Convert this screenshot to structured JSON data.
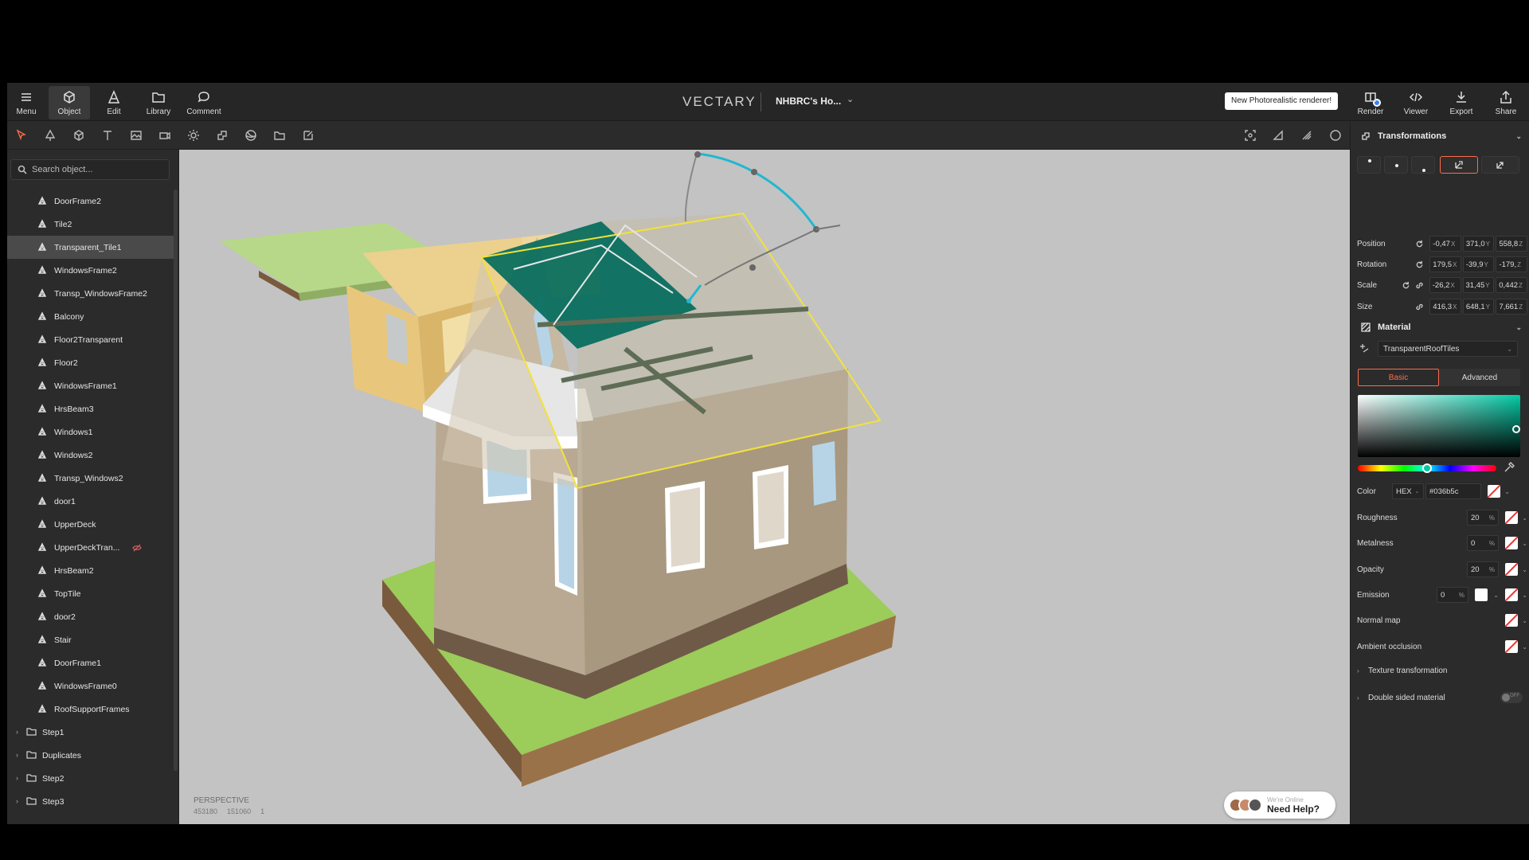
{
  "topbar": {
    "menu_label": "Menu",
    "object_label": "Object",
    "edit_label": "Edit",
    "library_label": "Library",
    "comment_label": "Comment",
    "logo": "VECTARY",
    "project_name": "NHBRC's Ho...",
    "renderer_tip": "New Photorealistic renderer!",
    "render_label": "Render",
    "viewer_label": "Viewer",
    "export_label": "Export",
    "share_label": "Share"
  },
  "tools": {
    "left": [
      "select-icon",
      "pen-icon",
      "box-icon",
      "text-icon",
      "image-icon",
      "camera-icon",
      "light-icon",
      "transform-icon",
      "sphere-icon",
      "folder-icon",
      "annotation-icon"
    ],
    "right": [
      "focus-icon",
      "material-preview-icon",
      "lighting-icon",
      "circle-icon"
    ]
  },
  "outliner": {
    "search_placeholder": "Search object...",
    "items": [
      {
        "label": "DoorFrame2",
        "selected": false,
        "hidden": false
      },
      {
        "label": "Tile2",
        "selected": false,
        "hidden": false
      },
      {
        "label": "Transparent_Tile1",
        "selected": true,
        "hidden": false
      },
      {
        "label": "WindowsFrame2",
        "selected": false,
        "hidden": false
      },
      {
        "label": "Transp_WindowsFrame2",
        "selected": false,
        "hidden": false
      },
      {
        "label": "Balcony",
        "selected": false,
        "hidden": false
      },
      {
        "label": "Floor2Transparent",
        "selected": false,
        "hidden": false
      },
      {
        "label": "Floor2",
        "selected": false,
        "hidden": false
      },
      {
        "label": "WindowsFrame1",
        "selected": false,
        "hidden": false
      },
      {
        "label": "HrsBeam3",
        "selected": false,
        "hidden": false
      },
      {
        "label": "Windows1",
        "selected": false,
        "hidden": false
      },
      {
        "label": "Windows2",
        "selected": false,
        "hidden": false
      },
      {
        "label": "Transp_Windows2",
        "selected": false,
        "hidden": false
      },
      {
        "label": "door1",
        "selected": false,
        "hidden": false
      },
      {
        "label": "UpperDeck",
        "selected": false,
        "hidden": false
      },
      {
        "label": "UpperDeckTran...",
        "selected": false,
        "hidden": true
      },
      {
        "label": "HrsBeam2",
        "selected": false,
        "hidden": false
      },
      {
        "label": "TopTile",
        "selected": false,
        "hidden": false
      },
      {
        "label": "door2",
        "selected": false,
        "hidden": false
      },
      {
        "label": "Stair",
        "selected": false,
        "hidden": false
      },
      {
        "label": "DoorFrame1",
        "selected": false,
        "hidden": false
      },
      {
        "label": "WindowsFrame0",
        "selected": false,
        "hidden": false
      },
      {
        "label": "RoofSupportFrames",
        "selected": false,
        "hidden": false
      }
    ],
    "folders": [
      "Step1",
      "Duplicates",
      "Step2",
      "Step3"
    ]
  },
  "viewport": {
    "mode": "PERSPECTIVE",
    "stats": [
      "453180",
      "151060",
      "1"
    ],
    "help_online": "We're Online",
    "help_label": "Need Help?",
    "colors": {
      "roof": "#036b5c",
      "ground": "#9ccc5a",
      "soil": "#7a5a3c",
      "walls": "#b9a892",
      "second_floor": "#edd190",
      "selection": "#f2e23a",
      "gizmo": "#1fb8d0"
    }
  },
  "transformations": {
    "title": "Transformations",
    "rows": [
      {
        "label": "Position",
        "values": [
          "-0,47",
          "371,0",
          "558,8"
        ]
      },
      {
        "label": "Rotation",
        "values": [
          "179,5",
          "-39,9",
          "-179,"
        ]
      },
      {
        "label": "Scale",
        "values": [
          "-26,2",
          "31,45",
          "0,442"
        ]
      },
      {
        "label": "Size",
        "values": [
          "416,3",
          "648,1",
          "7,661"
        ]
      }
    ],
    "axes": [
      "X",
      "Y",
      "Z"
    ]
  },
  "material": {
    "title": "Material",
    "name": "TransparentRoofTiles",
    "tab_basic": "Basic",
    "tab_advanced": "Advanced",
    "color_label": "Color",
    "color_format": "HEX",
    "color_hex": "#036b5c",
    "picker_color": "#04c9a5",
    "roughness_label": "Roughness",
    "roughness": "20",
    "metalness_label": "Metalness",
    "metalness": "0",
    "opacity_label": "Opacity",
    "opacity": "20",
    "emission_label": "Emission",
    "emission": "0",
    "percent": "%",
    "normal_map_label": "Normal map",
    "ao_label": "Ambient occlusion",
    "texture_transform_label": "Texture transformation",
    "double_sided_label": "Double sided material",
    "double_sided_state": "OFF"
  }
}
